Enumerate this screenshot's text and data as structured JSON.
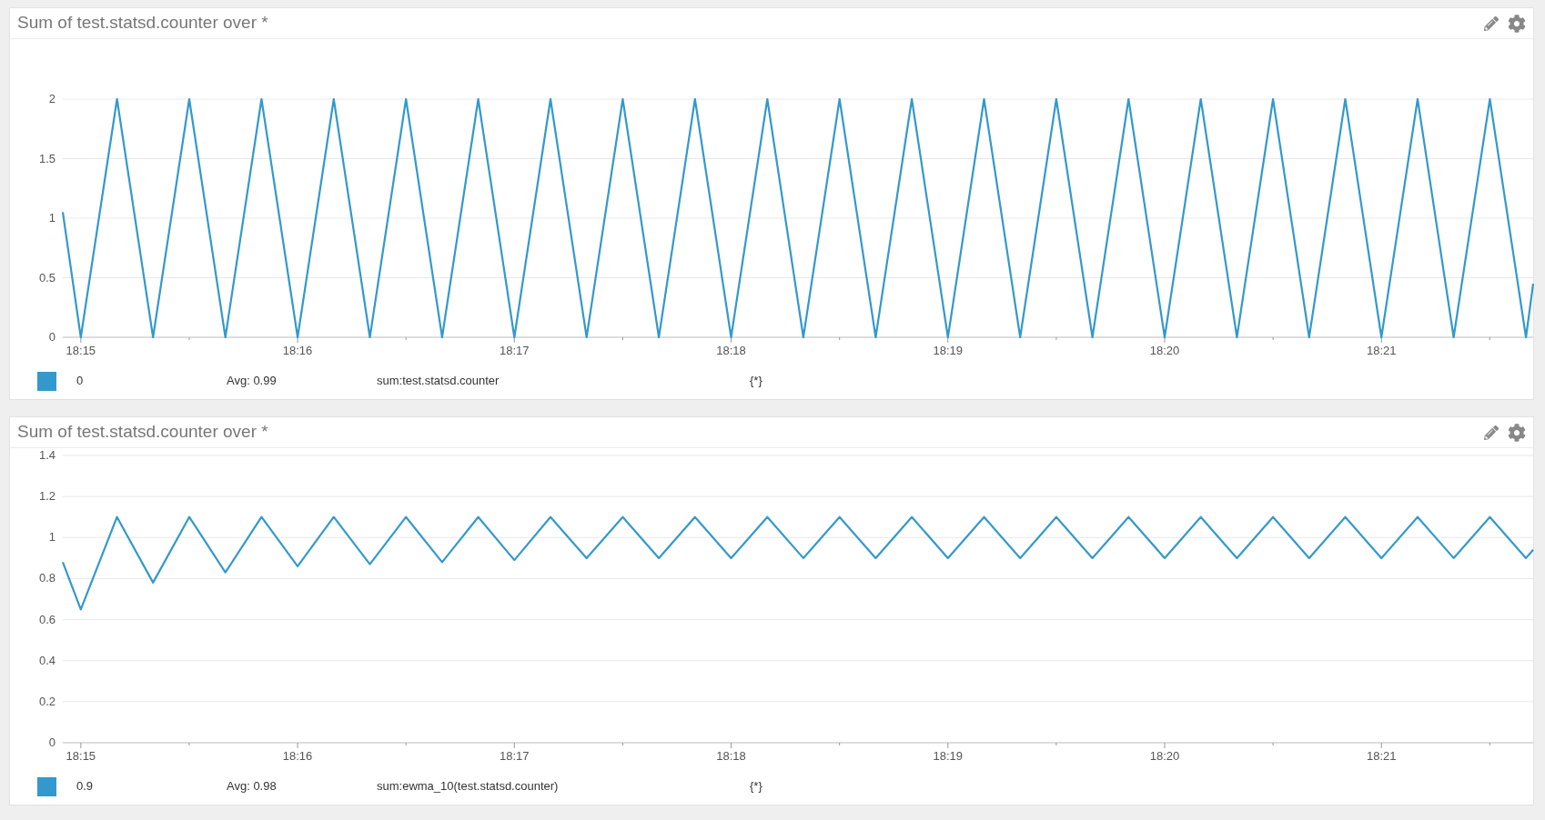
{
  "panels": [
    {
      "title": "Sum of test.statsd.counter over *",
      "chart_data": {
        "type": "line",
        "x": [
          1094.9167,
          1095,
          1095.1667,
          1095.3333,
          1095.5,
          1095.6667,
          1095.8333,
          1096,
          1096.1667,
          1096.3333,
          1096.5,
          1096.6667,
          1096.8333,
          1097,
          1097.1667,
          1097.3333,
          1097.5,
          1097.6667,
          1097.8333,
          1098,
          1098.1667,
          1098.3333,
          1098.5,
          1098.6667,
          1098.8333,
          1099,
          1099.1667,
          1099.3333,
          1099.5,
          1099.6667,
          1099.8333,
          1100,
          1100.1667,
          1100.3333,
          1100.5,
          1100.6667,
          1100.8333,
          1101,
          1101.1667,
          1101.3333,
          1101.5,
          1101.6667,
          1101.7
        ],
        "xlim": [
          1094.9167,
          1101.7
        ],
        "grid": true,
        "ylim": [
          0,
          2
        ],
        "yticks": [
          0,
          0.5,
          1,
          1.5,
          2
        ],
        "xticks": [
          {
            "value": 1095,
            "label": "18:15"
          },
          {
            "value": 1096,
            "label": "18:16"
          },
          {
            "value": 1097,
            "label": "18:17"
          },
          {
            "value": 1098,
            "label": "18:18"
          },
          {
            "value": 1099,
            "label": "18:19"
          },
          {
            "value": 1100,
            "label": "18:20"
          },
          {
            "value": 1101,
            "label": "18:21"
          }
        ],
        "series": [
          {
            "name": "sum:test.statsd.counter",
            "color": "#3399cc",
            "values": [
              1.05,
              0,
              2,
              0,
              2,
              0,
              2,
              0,
              2,
              0,
              2,
              0,
              2,
              0,
              2,
              0,
              2,
              0,
              2,
              0,
              2,
              0,
              2,
              0,
              2,
              0,
              2,
              0,
              2,
              0,
              2,
              0,
              2,
              0,
              2,
              0,
              2,
              0,
              2,
              0,
              2,
              0,
              0.45
            ]
          }
        ]
      },
      "legend": [
        {
          "color": "#3399cc",
          "value": "0",
          "avg": "Avg: 0.99",
          "scope": "{*}"
        }
      ]
    },
    {
      "title": "Sum of test.statsd.counter over *",
      "chart_data": {
        "type": "line",
        "x": [
          1094.9167,
          1095,
          1095.1667,
          1095.3333,
          1095.5,
          1095.6667,
          1095.8333,
          1096,
          1096.1667,
          1096.3333,
          1096.5,
          1096.6667,
          1096.8333,
          1097,
          1097.1667,
          1097.3333,
          1097.5,
          1097.6667,
          1097.8333,
          1098,
          1098.1667,
          1098.3333,
          1098.5,
          1098.6667,
          1098.8333,
          1099,
          1099.1667,
          1099.3333,
          1099.5,
          1099.6667,
          1099.8333,
          1100,
          1100.1667,
          1100.3333,
          1100.5,
          1100.6667,
          1100.8333,
          1101,
          1101.1667,
          1101.3333,
          1101.5,
          1101.6667,
          1101.7
        ],
        "xlim": [
          1094.9167,
          1101.7
        ],
        "grid": true,
        "ylim": [
          0,
          1.4
        ],
        "yticks": [
          0,
          0.2,
          0.4,
          0.6,
          0.8,
          1,
          1.2,
          1.4
        ],
        "xticks": [
          {
            "value": 1095,
            "label": "18:15"
          },
          {
            "value": 1096,
            "label": "18:16"
          },
          {
            "value": 1097,
            "label": "18:17"
          },
          {
            "value": 1098,
            "label": "18:18"
          },
          {
            "value": 1099,
            "label": "18:19"
          },
          {
            "value": 1100,
            "label": "18:20"
          },
          {
            "value": 1101,
            "label": "18:21"
          }
        ],
        "series": [
          {
            "name": "sum:ewma_10(test.statsd.counter)",
            "color": "#3399cc",
            "values": [
              0.88,
              0.65,
              1.1,
              0.78,
              1.1,
              0.83,
              1.1,
              0.86,
              1.1,
              0.87,
              1.1,
              0.88,
              1.1,
              0.89,
              1.1,
              0.9,
              1.1,
              0.9,
              1.1,
              0.9,
              1.1,
              0.9,
              1.1,
              0.9,
              1.1,
              0.9,
              1.1,
              0.9,
              1.1,
              0.9,
              1.1,
              0.9,
              1.1,
              0.9,
              1.1,
              0.9,
              1.1,
              0.9,
              1.1,
              0.9,
              1.1,
              0.9,
              0.94
            ]
          }
        ]
      },
      "legend": [
        {
          "color": "#3399cc",
          "value": "0.9",
          "avg": "Avg: 0.98",
          "scope": "{*}"
        }
      ]
    }
  ]
}
